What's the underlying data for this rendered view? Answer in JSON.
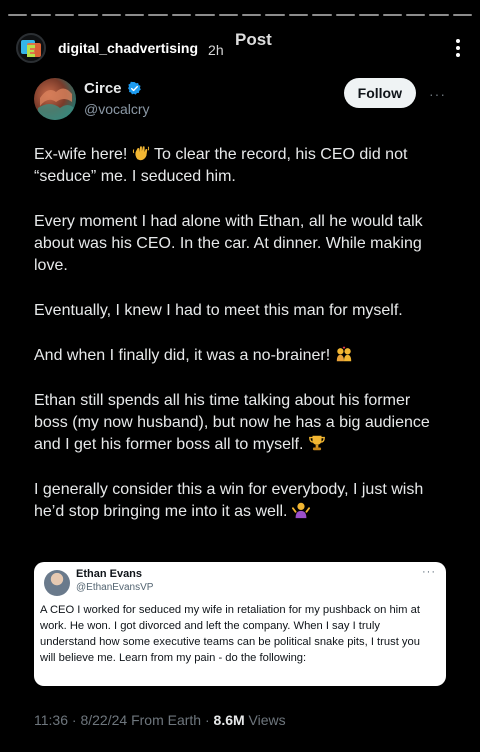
{
  "story": {
    "username": "digital_chadvertising",
    "time_ago": "2h",
    "overlay_label": "Post",
    "progress_segments": 20
  },
  "tweet": {
    "display_name": "Circe",
    "handle": "@vocalcry",
    "follow_label": "Follow",
    "more_label": "···",
    "paragraphs": [
      {
        "text": "Ex-wife here! ",
        "emoji": "waving-hand-icon",
        "text_after": " To clear the record, his CEO did not “seduce” me. I seduced him."
      },
      {
        "text": "Every moment I had alone with Ethan, all he would talk about was his CEO. In the car. At dinner. While making love."
      },
      {
        "text": "Eventually, I knew I had to meet this man for myself."
      },
      {
        "text": "And when I finally did, it was a no-brainer! ",
        "emoji": "couple-kiss-icon"
      },
      {
        "text": "Ethan still spends all his time talking about his former boss (my now husband), but now he has a big audience and I get his former boss all to myself. ",
        "emoji": "trophy-icon"
      },
      {
        "text": "I generally consider this a win for everybody, I just wish he’d stop bringing me into it as well. ",
        "emoji": "shrug-icon"
      }
    ],
    "meta": {
      "time": "11:36",
      "date": "8/22/24",
      "source": "From Earth",
      "views_count": "8.6M",
      "views_label": "Views"
    }
  },
  "quote": {
    "display_name": "Ethan Evans",
    "handle": "@EthanEvansVP",
    "more_label": "···",
    "text": "A CEO I worked for seduced my wife in retaliation for my pushback on him at work. He won. I got divorced and left the company. When I say I truly understand how some executive teams can be political snake pits, I trust you will believe me. Learn from my pain - do the following:"
  },
  "colors": {
    "background": "#000000",
    "text": "#e7e9ea",
    "secondary_text": "#6e767d",
    "verified": "#1d9bf0",
    "follow_bg": "#eff3f4"
  }
}
